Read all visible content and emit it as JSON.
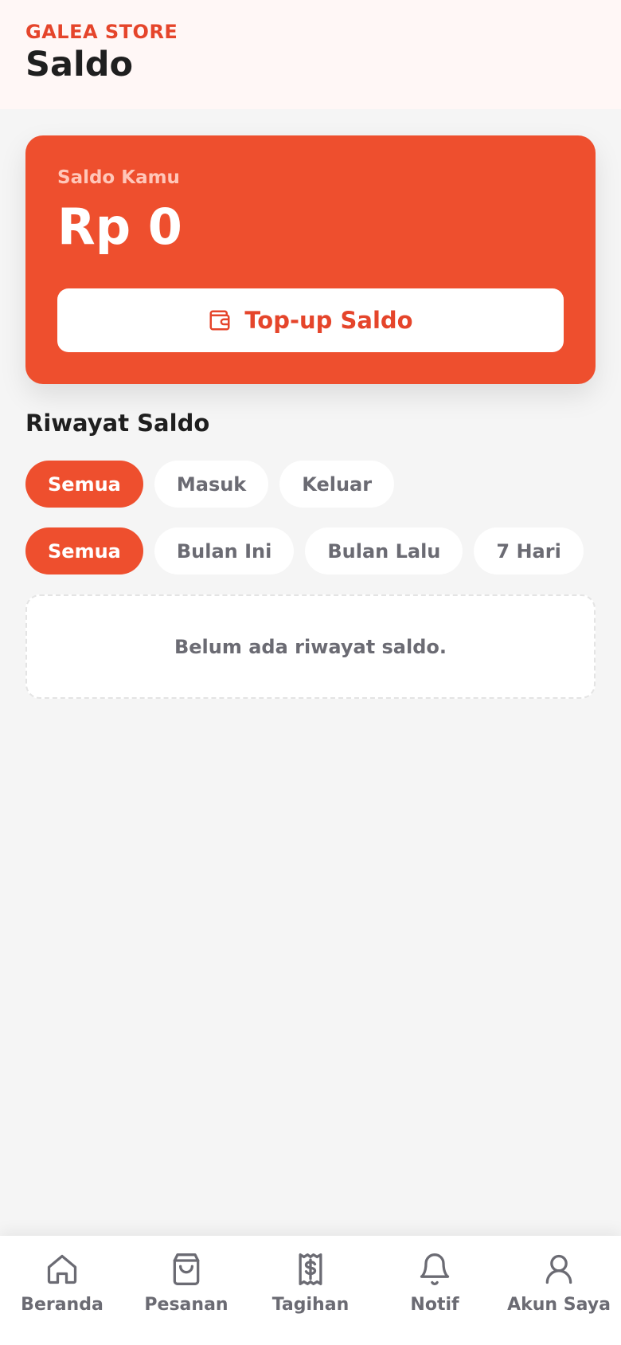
{
  "header": {
    "brand": "GALEA STORE",
    "title": "Saldo"
  },
  "balance": {
    "label": "Saldo Kamu",
    "amount": "Rp 0",
    "topup_label": "Top-up Saldo"
  },
  "history": {
    "title": "Riwayat Saldo",
    "type_filters": [
      "Semua",
      "Masuk",
      "Keluar"
    ],
    "type_selected": "Semua",
    "period_filters": [
      "Semua",
      "Bulan Ini",
      "Bulan Lalu",
      "7 Hari"
    ],
    "period_selected": "Semua",
    "empty_text": "Belum ada riwayat saldo."
  },
  "nav": {
    "items": [
      {
        "label": "Beranda",
        "icon": "home-icon"
      },
      {
        "label": "Pesanan",
        "icon": "shopping-bag-icon"
      },
      {
        "label": "Tagihan",
        "icon": "receipt-icon"
      },
      {
        "label": "Notif",
        "icon": "bell-icon"
      },
      {
        "label": "Akun Saya",
        "icon": "user-icon"
      }
    ]
  },
  "colors": {
    "accent": "#ee4f2e",
    "brand_text": "#e5452b",
    "muted": "#6b6b73"
  }
}
